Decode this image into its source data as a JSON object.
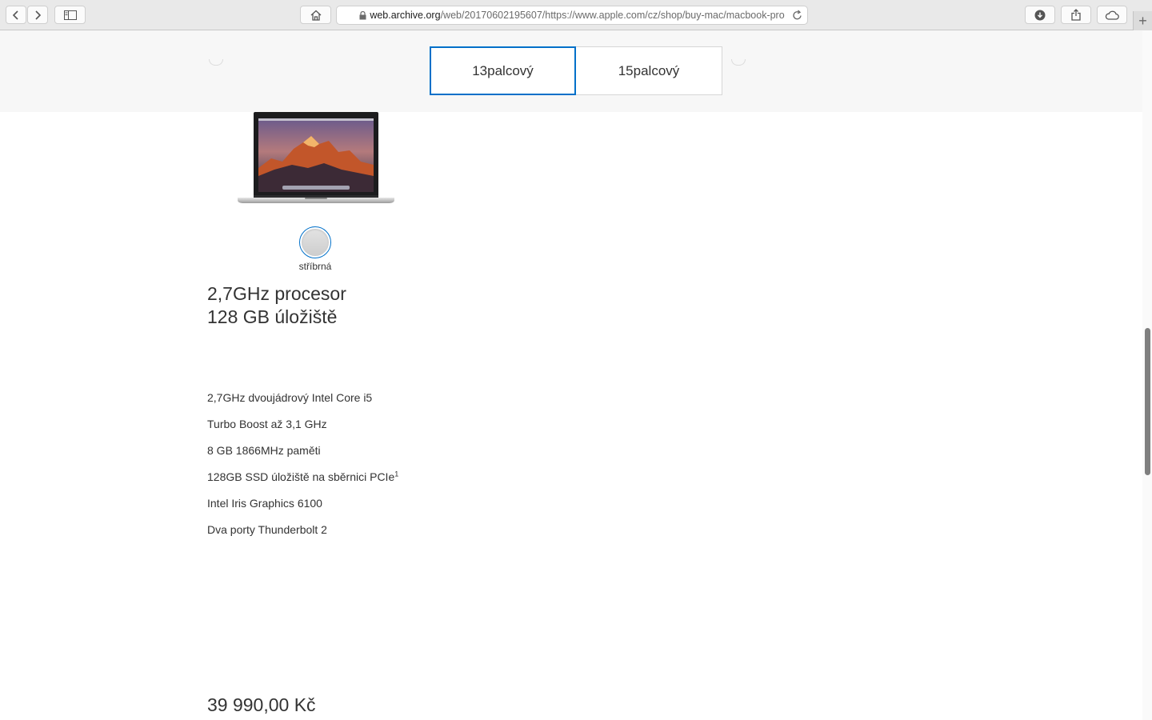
{
  "browser": {
    "url_host": "web.archive.org",
    "url_path": "/web/20170602195607/https://www.apple.com/cz/shop/buy-mac/macbook-pro"
  },
  "size_selector": {
    "options": [
      {
        "label": "13palcový",
        "selected": true
      },
      {
        "label": "15palcový",
        "selected": false
      }
    ]
  },
  "product": {
    "color_label": "stříbrná",
    "headline_line1": "2,7GHz procesor",
    "headline_line2": "128 GB úložiště",
    "specs": [
      "2,7GHz dvoujádrový Intel Core i5",
      "Turbo Boost až 3,1 GHz",
      "8 GB 1866MHz paměti",
      "128GB SSD úložiště na sběrnici PCIe",
      "Intel Iris Graphics 6100",
      "Dva porty Thunderbolt 2"
    ],
    "footnote_mark": "1",
    "price": "39 990,00 Kč"
  },
  "colors": {
    "accent": "#0070c9",
    "text": "#333333"
  }
}
